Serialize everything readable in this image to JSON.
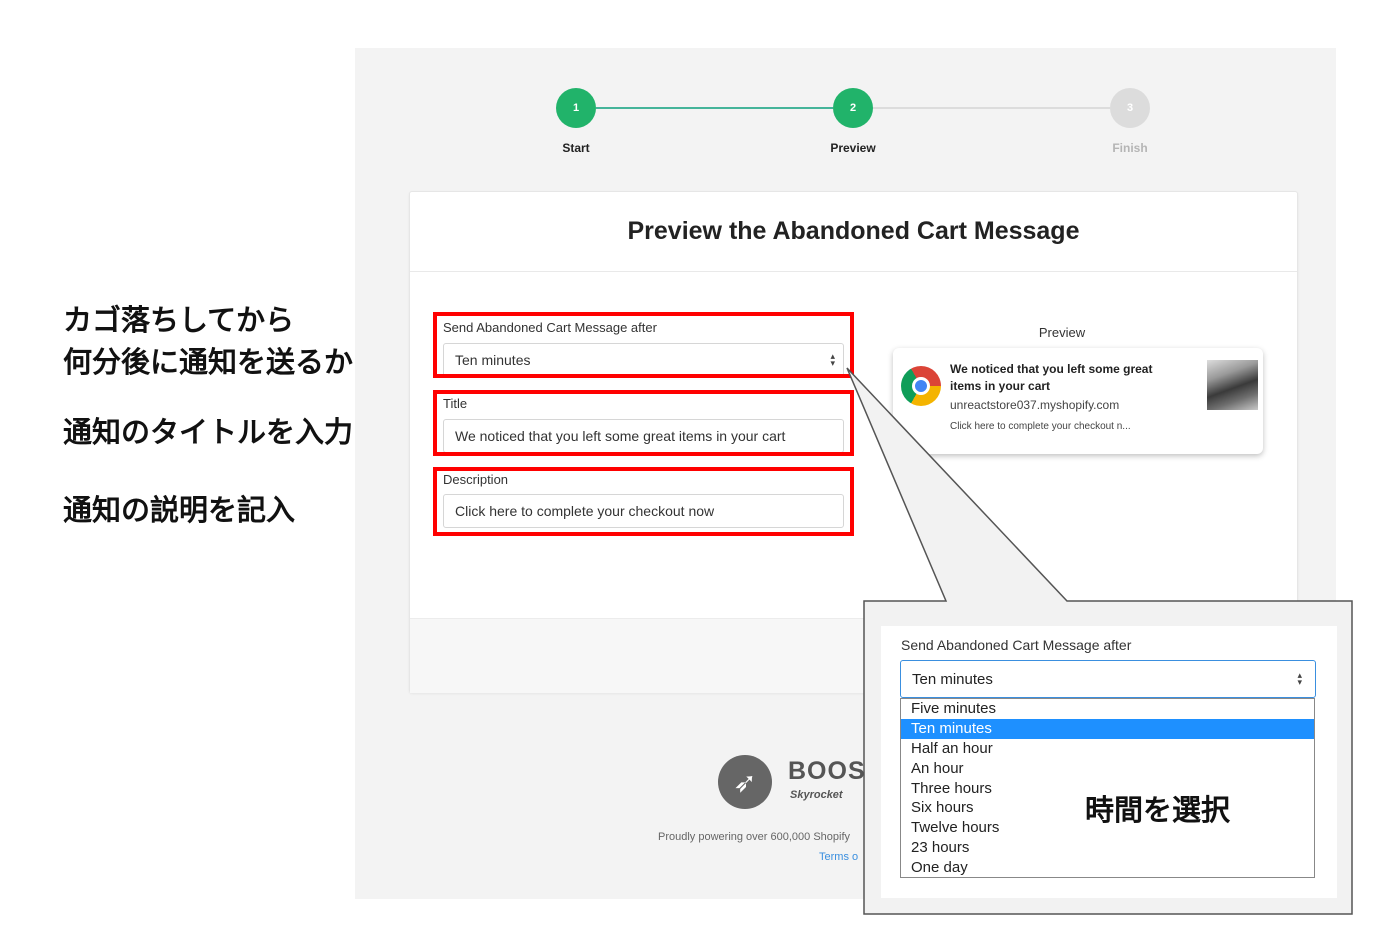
{
  "stepper": {
    "steps": [
      {
        "number": "1",
        "label": "Start"
      },
      {
        "number": "2",
        "label": "Preview"
      },
      {
        "number": "3",
        "label": "Finish"
      }
    ],
    "active_color": "#21b36a",
    "inactive_color": "#dcdcdc",
    "line_active_color": "#45b49a"
  },
  "card": {
    "title": "Preview the Abandoned Cart Message"
  },
  "form": {
    "send_after_label": "Send Abandoned Cart Message after",
    "send_after_value": "Ten minutes",
    "title_label": "Title",
    "title_value": "We noticed that you left some great items in your cart",
    "description_label": "Description",
    "description_value": "Click here to complete your checkout now"
  },
  "preview": {
    "label": "Preview",
    "notification": {
      "title": "We noticed that you left some great items in your cart",
      "domain": "unreactstore037.myshopify.com",
      "body": "Click here to complete your checkout n..."
    }
  },
  "footer": {
    "brand": "BOOS",
    "tagline": "Skyrocket",
    "powered": "Proudly powering over 600,000 Shopify",
    "terms": "Terms o"
  },
  "callout": {
    "label": "Send Abandoned Cart Message after",
    "selected": "Ten minutes",
    "options": [
      "Five minutes",
      "Ten minutes",
      "Half an hour",
      "An hour",
      "Three hours",
      "Six hours",
      "Twelve hours",
      "23 hours",
      "One day"
    ],
    "selected_index": 1,
    "selection_color": "#1e90ff"
  },
  "annotations": {
    "send_after_line1": "カゴ落ちしてから",
    "send_after_line2": "何分後に通知を送るか",
    "title": "通知のタイトルを入力",
    "description": "通知の説明を記入",
    "select_time": "時間を選択"
  },
  "colors": {
    "highlight_frame": "#ff0000",
    "link": "#3a8fdf"
  }
}
